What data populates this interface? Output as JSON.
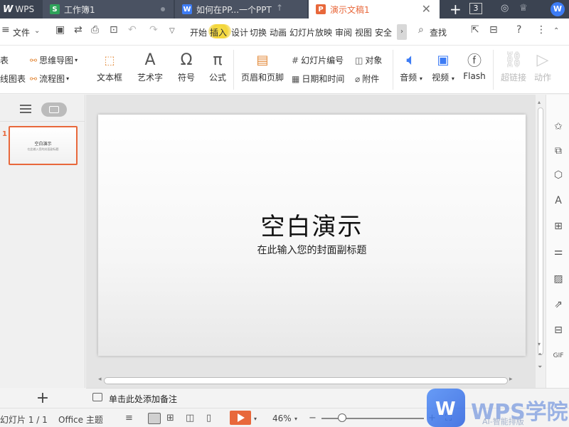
{
  "tabs": {
    "wps_label": "WPS",
    "sheet_label": "工作簿1",
    "doc_label": "如何在PP...一个PPT",
    "ppt_label": "演示文稿1",
    "window_count": "3",
    "icons": {
      "wps": "wps-logo-icon",
      "sheet": "spreadsheet-icon",
      "doc": "document-icon",
      "ppt": "presentation-icon"
    }
  },
  "menubar": {
    "file_label": "文件",
    "items": [
      "开始",
      "插入",
      "设计",
      "切换",
      "动画",
      "幻灯片放映",
      "审阅",
      "视图",
      "安全"
    ],
    "search_label": "查找",
    "active_item": "插入",
    "active_color": "#f3d53a"
  },
  "ribbon": {
    "left_top_partial": "表",
    "left_bottom_partial": "线图表",
    "mindmap": "思维导图",
    "flowchart": "流程图",
    "textbox": "文本框",
    "arttext": "艺术字",
    "symbol": "符号",
    "formula": "公式",
    "header_footer": "页眉和页脚",
    "slide_number": "幻灯片编号",
    "datetime": "日期和时间",
    "object": "对象",
    "attachment": "附件",
    "audio": "音频",
    "video": "视频",
    "flash": "Flash",
    "hyperlink": "超链接",
    "action": "动作"
  },
  "slides": {
    "current_number": "1",
    "thumb_title": "空白演示",
    "thumb_sub": "在此输入您的封面副标题"
  },
  "slide": {
    "title": "空白演示",
    "subtitle": "在此输入您的封面副标题"
  },
  "notes": {
    "placeholder": "单击此处添加备注"
  },
  "statusbar": {
    "slide_info": "幻灯片 1 / 1",
    "theme": "Office 主题",
    "zoom": "46%"
  },
  "watermark": {
    "brand": "WPS学院",
    "ai_label": "AI-智能排版"
  },
  "colors": {
    "accent": "#e8683b",
    "wps_blue": "#3d7cf5",
    "titlebar": "#3b4351"
  }
}
